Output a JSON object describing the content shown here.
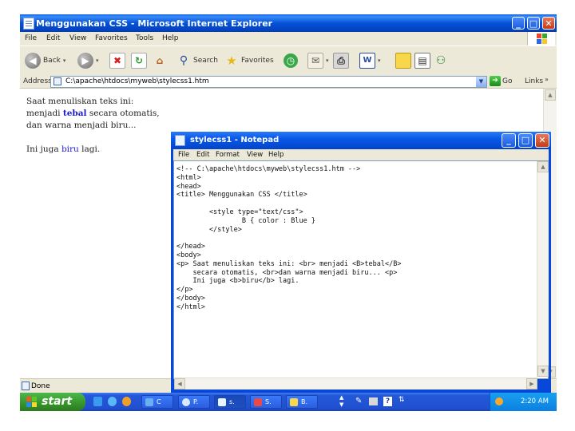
{
  "ie": {
    "title": "Menggunakan CSS - Microsoft Internet Explorer",
    "menu": [
      "File",
      "Edit",
      "View",
      "Favorites",
      "Tools",
      "Help"
    ],
    "toolbar": {
      "back": "Back",
      "search": "Search",
      "favorites": "Favorites"
    },
    "address": {
      "label": "Address",
      "value": "C:\\apache\\htdocs\\myweb\\stylecss1.htm",
      "go": "Go",
      "links": "Links"
    },
    "content": {
      "line1": "Saat menuliskan teks ini:",
      "line2_pre": "menjadi ",
      "line2_bold": "tebal",
      "line2_post": " secara otomatis,",
      "line3": "dan warna menjadi biru...",
      "line4_pre": "Ini juga ",
      "line4_blue": "biru",
      "line4_post": " lagi."
    },
    "status": "Done"
  },
  "notepad": {
    "title": "stylecss1 - Notepad",
    "menu": [
      "File",
      "Edit",
      "Format",
      "View",
      "Help"
    ],
    "code": [
      "<!-- C:\\apache\\htdocs\\myweb\\stylecss1.htm -->",
      "<html>",
      "<head>",
      "<title> Menggunakan CSS </title>",
      "",
      "        <style type=\"text/css\">",
      "                B { color : Blue }",
      "        </style>",
      "",
      "</head>",
      "<body>",
      "<p> Saat menuliskan teks ini: <br> menjadi <B>tebal</B>",
      "    secara otomatis, <br>dan warna menjadi biru... <p>",
      "    Ini juga <b>biru</b> lagi.",
      "</p>",
      "</body>",
      "</html>"
    ]
  },
  "taskbar": {
    "start": "start",
    "tasks": [
      "C",
      "P.",
      "s.",
      "S.",
      "B."
    ],
    "clock": "2:20 AM"
  },
  "colors": {
    "titlebar": "#0a58e8",
    "taskbar": "#2458d8",
    "start": "#3a9a2e",
    "link_blue": "#1a1acc"
  }
}
